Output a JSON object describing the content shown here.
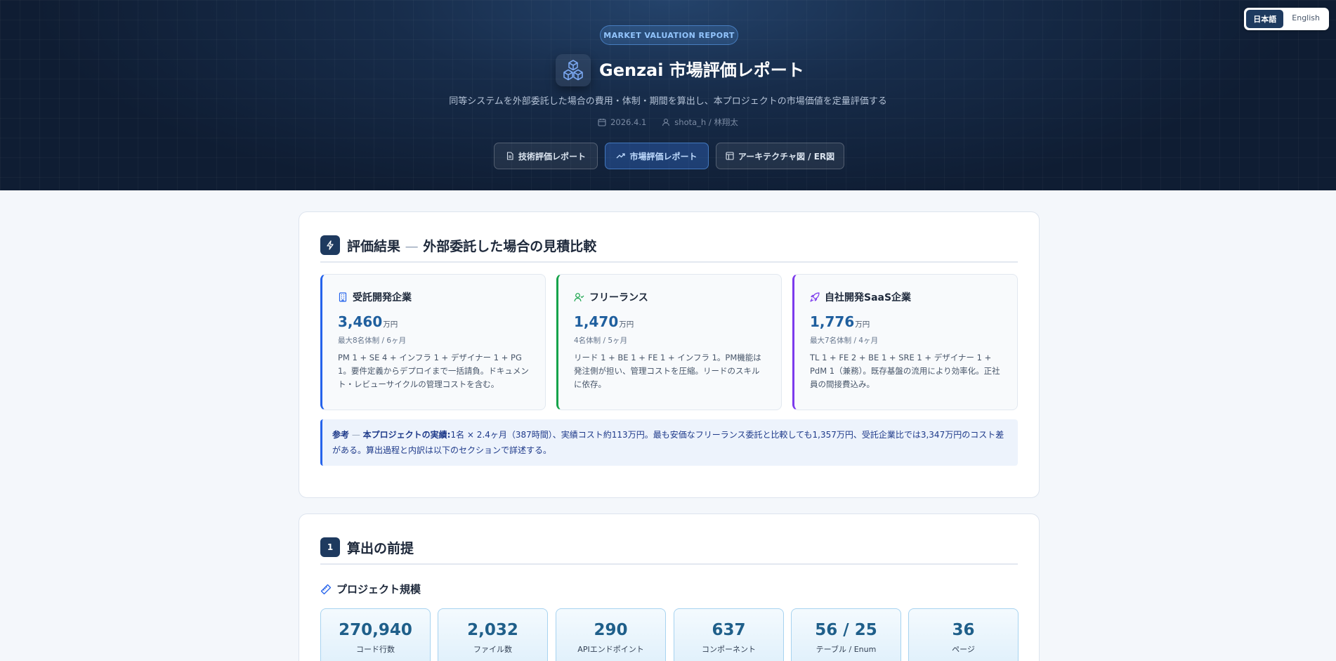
{
  "lang": {
    "ja": "日本語",
    "en": "English"
  },
  "hero": {
    "badge": "MARKET VALUATION REPORT",
    "title": "Genzai 市場評価レポート",
    "subtitle": "同等システムを外部委託した場合の費用・体制・期間を算出し、本プロジェクトの市場価値を定量評価する",
    "date": "2026.4.1",
    "author": "shota_h / 林翔太"
  },
  "nav": [
    {
      "label": "技術評価レポート",
      "icon": "document-icon",
      "active": false
    },
    {
      "label": "市場評価レポート",
      "icon": "trending-up-icon",
      "active": true
    },
    {
      "label": "アーキテクチャ図 / ER図",
      "icon": "layout-icon",
      "active": false
    }
  ],
  "summary": {
    "title_main": "評価結果",
    "title_dash": "—",
    "title_sub": "外部委託した場合の見積比較",
    "cards": [
      {
        "name": "受託開発企業",
        "icon": "building-icon",
        "value": "3,460",
        "unit": "万円",
        "team": "最大8名体制 / 6ヶ月",
        "desc": "PM 1 + SE 4 + インフラ 1 + デザイナー 1 + PG 1。要件定義からデプロイまで一括請負。ドキュメント・レビューサイクルの管理コストを含む。",
        "accent": "#2563eb"
      },
      {
        "name": "フリーランス",
        "icon": "user-check-icon",
        "value": "1,470",
        "unit": "万円",
        "team": "4名体制 / 5ヶ月",
        "desc": "リード 1 + BE 1 + FE 1 + インフラ 1。PM機能は発注側が担い、管理コストを圧縮。リードのスキルに依存。",
        "accent": "#16a34a"
      },
      {
        "name": "自社開発SaaS企業",
        "icon": "rocket-icon",
        "value": "1,776",
        "unit": "万円",
        "team": "最大7名体制 / 4ヶ月",
        "desc": "TL 1 + FE 2 + BE 1 + SRE 1 + デザイナー 1 + PdM 1（兼務）。既存基盤の流用により効率化。正社員の間接費込み。",
        "accent": "#7c3aed"
      }
    ],
    "note_label": "参考",
    "note_dash": "—",
    "note_strong": "本プロジェクトの実績:",
    "note_text": "1名 × 2.4ヶ月（387時間）、実績コスト約113万円。最も安価なフリーランス委託と比較しても1,357万円、受託企業比では3,347万円のコスト差がある。算出過程と内訳は以下のセクションで詳述する。"
  },
  "section1": {
    "number": "1",
    "title": "算出の前提",
    "sub_title": "プロジェクト規模",
    "stats": [
      {
        "value": "270,940",
        "label": "コード行数"
      },
      {
        "value": "2,032",
        "label": "ファイル数"
      },
      {
        "value": "290",
        "label": "APIエンドポイント"
      },
      {
        "value": "637",
        "label": "コンポーネント"
      },
      {
        "value": "56 / 25",
        "label": "テーブル / Enum"
      },
      {
        "value": "36",
        "label": "ページ"
      }
    ]
  },
  "colors": {
    "accent": "#1f5f9e",
    "hero_bg": "#172c4a",
    "section_icon": "#1e3a5f"
  }
}
